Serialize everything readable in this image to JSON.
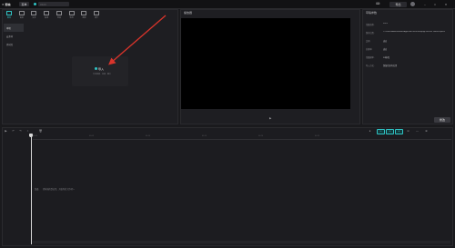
{
  "app": {
    "name": "剪映",
    "project_name": "0323"
  },
  "topbar": {
    "menu_label": "菜单",
    "shortcut_label": "快捷键",
    "export_label": "导出"
  },
  "tools": [
    {
      "label": "媒体",
      "active": true
    },
    {
      "label": "音频"
    },
    {
      "label": "文本"
    },
    {
      "label": "贴纸"
    },
    {
      "label": "特效"
    },
    {
      "label": "转场"
    },
    {
      "label": "滤镜"
    },
    {
      "label": "调节"
    }
  ],
  "sidebar": {
    "items": [
      {
        "label": "本地",
        "active": true
      },
      {
        "label": "云素材"
      },
      {
        "label": "素材库"
      }
    ]
  },
  "import": {
    "label": "导入",
    "hint": "支持视频、音频、图片"
  },
  "player": {
    "title": "播放器"
  },
  "draft": {
    "title": "草稿参数",
    "rows": [
      {
        "key": "草稿名称:",
        "value": "0323"
      },
      {
        "key": "保存位置:",
        "value": "C:/Users/Administrator/AppData/Local/JianyingPro/User Data/Projects"
      },
      {
        "key": "比例:",
        "value": "适应"
      },
      {
        "key": "分辨率:",
        "value": "适应"
      },
      {
        "key": "草稿帧率:",
        "value": "30帧/秒"
      },
      {
        "key": "导入方式:",
        "value": "保留在原有位置"
      }
    ],
    "modify_label": "修改"
  },
  "timeline": {
    "ticks": [
      "00:00",
      "00:05",
      "00:10",
      "00:15",
      "00:20",
      "00:25"
    ],
    "main_track_label": "封面",
    "drop_hint": "素材拖拽到这里，开始你的大作吧～"
  },
  "colors": {
    "accent": "#2fc3c4",
    "bg": "#1a1a1d",
    "panel": "#1e1e22",
    "arrow": "#d9342b"
  }
}
